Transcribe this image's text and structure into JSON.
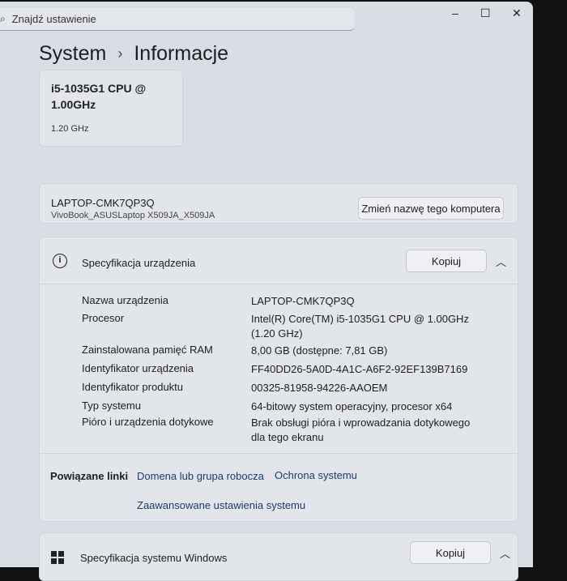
{
  "search": {
    "placeholder": "Znajdź ustawienie"
  },
  "window_controls": {
    "minimize": "–",
    "maximize": "☐",
    "close": "✕"
  },
  "breadcrumb": {
    "parent": "System",
    "separator": "›",
    "current": "Informacje"
  },
  "cpu_card": {
    "line1": "i5-1035G1 CPU @",
    "line2": "1.00GHz",
    "speed": "1.20 GHz"
  },
  "device_card": {
    "name": "LAPTOP-CMK7QP3Q",
    "model": "VivoBook_ASUSLaptop X509JA_X509JA",
    "rename_button": "Zmień nazwę tego komputera"
  },
  "device_spec": {
    "title": "Specyfikacja urządzenia",
    "copy_button": "Kopiuj",
    "rows": [
      {
        "label": "Nazwa urządzenia",
        "value": "LAPTOP-CMK7QP3Q"
      },
      {
        "label": "Procesor",
        "value": "Intel(R) Core(TM) i5-1035G1 CPU @ 1.00GHz (1.20 GHz)"
      },
      {
        "label": "Zainstalowana pamięć RAM",
        "value": "8,00 GB (dostępne: 7,81 GB)"
      },
      {
        "label": "Identyfikator urządzenia",
        "value": "FF40DD26-5A0D-4A1C-A6F2-92EF139B7169"
      },
      {
        "label": "Identyfikator produktu",
        "value": "00325-81958-94226-AAOEM"
      },
      {
        "label": "Typ systemu",
        "value": "64-bitowy system operacyjny, procesor x64"
      },
      {
        "label": "Pióro i urządzenia dotykowe",
        "value": "Brak obsługi pióra i wprowadzania dotykowego dla tego ekranu"
      }
    ]
  },
  "related": {
    "title": "Powiązane linki",
    "links": [
      "Domena lub grupa robocza",
      "Ochrona systemu",
      "Zaawansowane ustawienia systemu"
    ]
  },
  "windows_spec": {
    "title": "Specyfikacja systemu Windows",
    "copy_button": "Kopiuj"
  }
}
